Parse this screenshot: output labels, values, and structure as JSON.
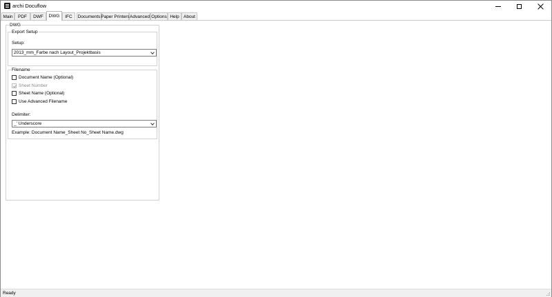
{
  "window": {
    "title": "archi Docuflow",
    "app_icon": "app-logo-icon",
    "controls": {
      "minimize": "minimize-icon",
      "maximize": "maximize-icon",
      "close": "close-icon"
    }
  },
  "tabs": [
    {
      "label": "Main"
    },
    {
      "label": "PDF"
    },
    {
      "label": "DWF"
    },
    {
      "label": "DWG"
    },
    {
      "label": "IFC"
    },
    {
      "label": "Documents"
    },
    {
      "label": "Paper Printers"
    },
    {
      "label": "Advanced"
    },
    {
      "label": "Options"
    },
    {
      "label": "Help"
    },
    {
      "label": "About"
    }
  ],
  "active_tab": "DWG",
  "dwg": {
    "group_title": "DWG",
    "export_setup": {
      "group_title": "Export Setup",
      "setup_label": "Setup:",
      "setup_value": "2013_mm_Farbe nach Layout_Projektbasis"
    },
    "filename": {
      "group_title": "Filename",
      "options": [
        {
          "label": "Document Name (Optional)",
          "checked": false,
          "enabled": true
        },
        {
          "label": "Sheet Number",
          "checked": true,
          "enabled": false
        },
        {
          "label": "Sheet Name (Optional)",
          "checked": false,
          "enabled": true
        },
        {
          "label": "Use Advanced Filename",
          "checked": false,
          "enabled": true
        }
      ],
      "delimiter_label": "Delimiter:",
      "delimiter_value": "_' Underscore",
      "example": "Example: Document Name_Sheet No_Sheet Name.dwg"
    }
  },
  "status": {
    "text": "Ready"
  }
}
